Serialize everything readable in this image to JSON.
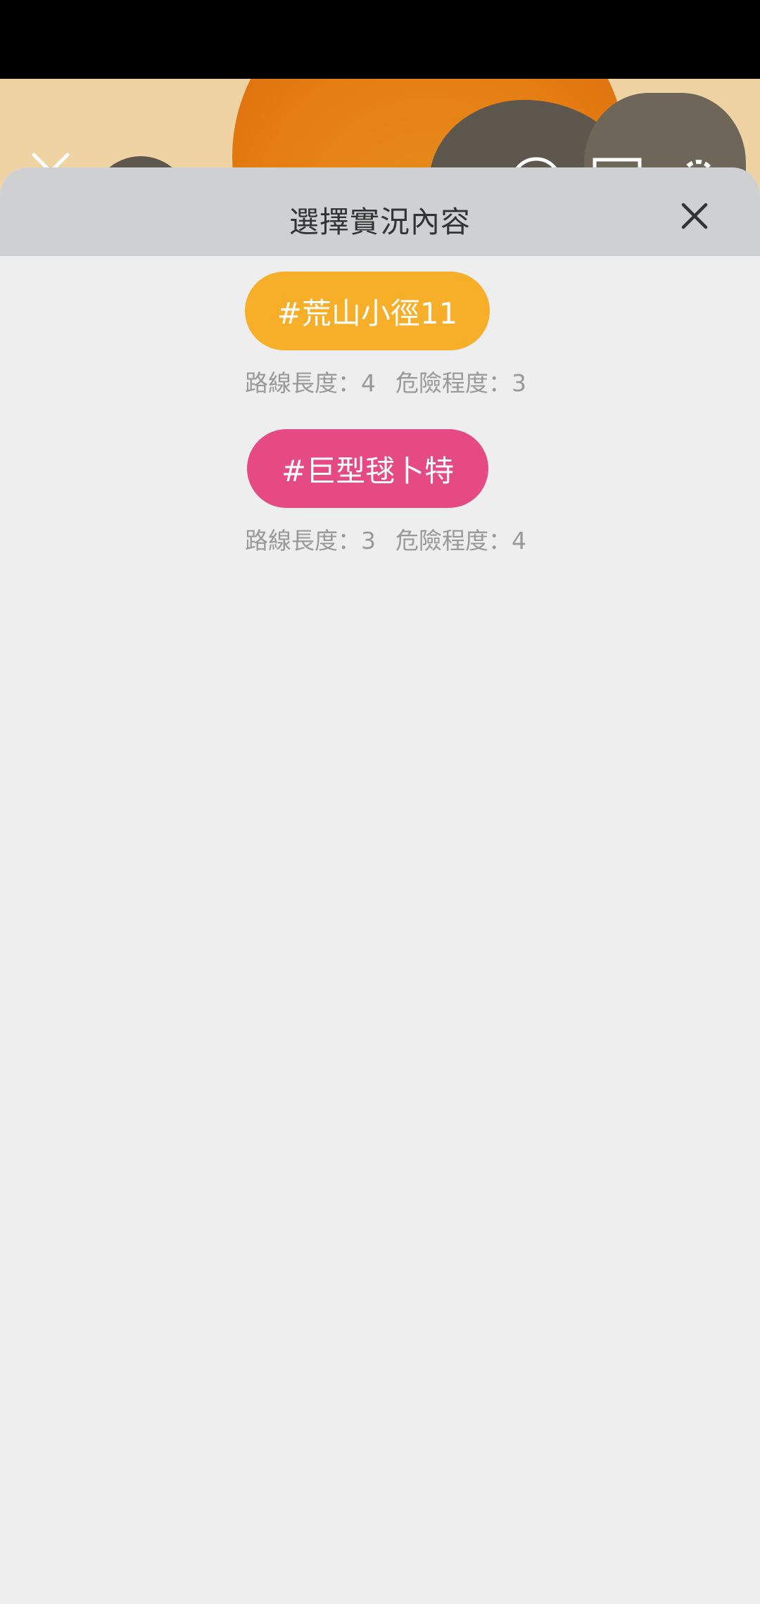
{
  "sheet": {
    "title": "選擇實況內容",
    "close_icon": "close-icon"
  },
  "background_icons": [
    "collapse-chevron-icon",
    "help-circle-icon",
    "square-icon",
    "settings-gear-icon"
  ],
  "routes": [
    {
      "tag": "#荒山小徑11",
      "color": "#f7af29",
      "length_text": "路線長度：4",
      "danger_text": "危險程度：3"
    },
    {
      "tag": "#巨型毬卜特",
      "color": "#e64a83",
      "length_text": "路線長度：3",
      "danger_text": "危險程度：4"
    }
  ]
}
